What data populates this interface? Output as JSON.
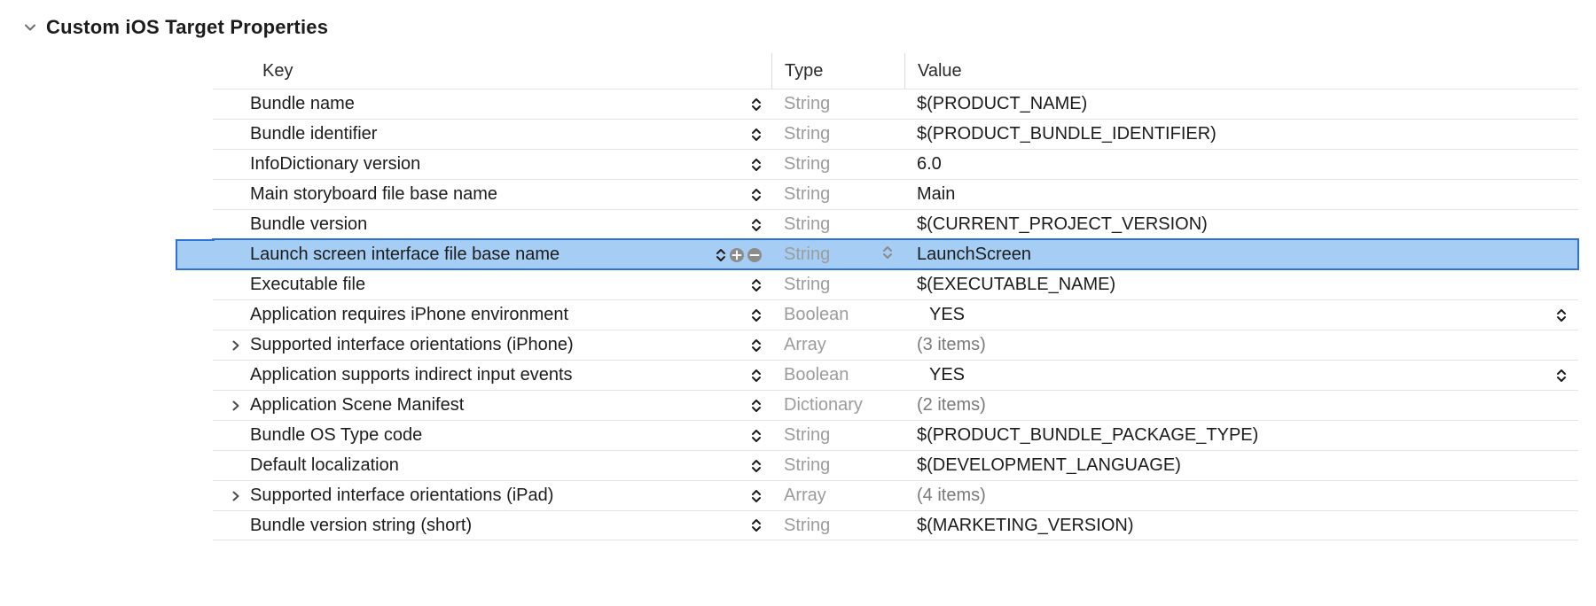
{
  "section": {
    "title": "Custom iOS Target Properties"
  },
  "columns": {
    "key": "Key",
    "type": "Type",
    "value": "Value"
  },
  "rows": [
    {
      "id": "bundle-name",
      "key": "Bundle name",
      "type": "String",
      "value": "$(PRODUCT_NAME)",
      "expandable": false,
      "selected": false
    },
    {
      "id": "bundle-identifier",
      "key": "Bundle identifier",
      "type": "String",
      "value": "$(PRODUCT_BUNDLE_IDENTIFIER)",
      "expandable": false,
      "selected": false
    },
    {
      "id": "infodictionary-version",
      "key": "InfoDictionary version",
      "type": "String",
      "value": "6.0",
      "expandable": false,
      "selected": false
    },
    {
      "id": "main-storyboard",
      "key": "Main storyboard file base name",
      "type": "String",
      "value": "Main",
      "expandable": false,
      "selected": false
    },
    {
      "id": "bundle-version",
      "key": "Bundle version",
      "type": "String",
      "value": "$(CURRENT_PROJECT_VERSION)",
      "expandable": false,
      "selected": false
    },
    {
      "id": "launch-screen",
      "key": "Launch screen interface file base name",
      "type": "String",
      "value": "LaunchScreen",
      "expandable": false,
      "selected": true
    },
    {
      "id": "executable-file",
      "key": "Executable file",
      "type": "String",
      "value": "$(EXECUTABLE_NAME)",
      "expandable": false,
      "selected": false
    },
    {
      "id": "requires-iphone-env",
      "key": "Application requires iPhone environment",
      "type": "Boolean",
      "value": "YES",
      "expandable": false,
      "selected": false,
      "valueIsBool": true
    },
    {
      "id": "orientations-iphone",
      "key": "Supported interface orientations (iPhone)",
      "type": "Array",
      "value": "(3 items)",
      "expandable": true,
      "selected": false,
      "paren": true
    },
    {
      "id": "indirect-input",
      "key": "Application supports indirect input events",
      "type": "Boolean",
      "value": "YES",
      "expandable": false,
      "selected": false,
      "valueIsBool": true
    },
    {
      "id": "scene-manifest",
      "key": "Application Scene Manifest",
      "type": "Dictionary",
      "value": "(2 items)",
      "expandable": true,
      "selected": false,
      "paren": true
    },
    {
      "id": "bundle-os-type",
      "key": "Bundle OS Type code",
      "type": "String",
      "value": "$(PRODUCT_BUNDLE_PACKAGE_TYPE)",
      "expandable": false,
      "selected": false
    },
    {
      "id": "default-localization",
      "key": "Default localization",
      "type": "String",
      "value": "$(DEVELOPMENT_LANGUAGE)",
      "expandable": false,
      "selected": false
    },
    {
      "id": "orientations-ipad",
      "key": "Supported interface orientations (iPad)",
      "type": "Array",
      "value": "(4 items)",
      "expandable": true,
      "selected": false,
      "paren": true
    },
    {
      "id": "bundle-version-short",
      "key": "Bundle version string (short)",
      "type": "String",
      "value": "$(MARKETING_VERSION)",
      "expandable": false,
      "selected": false
    }
  ]
}
